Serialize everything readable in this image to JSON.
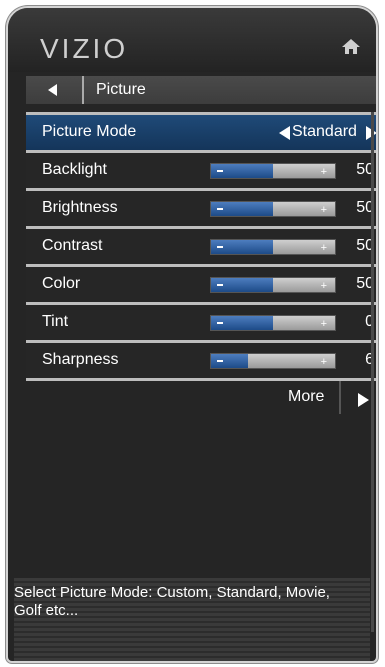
{
  "header": {
    "logo": "VIZIO"
  },
  "nav": {
    "title": "Picture"
  },
  "picture_mode": {
    "label": "Picture Mode",
    "value": "Standard"
  },
  "settings": [
    {
      "label": "Backlight",
      "value": "50",
      "level": 0.5
    },
    {
      "label": "Brightness",
      "value": "50",
      "level": 0.5
    },
    {
      "label": "Contrast",
      "value": "50",
      "level": 0.5
    },
    {
      "label": "Color",
      "value": "50",
      "level": 0.5
    },
    {
      "label": "Tint",
      "value": "0",
      "level": 0.5
    },
    {
      "label": "Sharpness",
      "value": "6",
      "level": 0.3
    }
  ],
  "more": {
    "label": "More"
  },
  "help": {
    "text": "Select Picture Mode: Custom, Standard, Movie, Golf etc..."
  },
  "colors": {
    "selection": "#1f4a78",
    "slider_fill": "#2f5c9f"
  }
}
